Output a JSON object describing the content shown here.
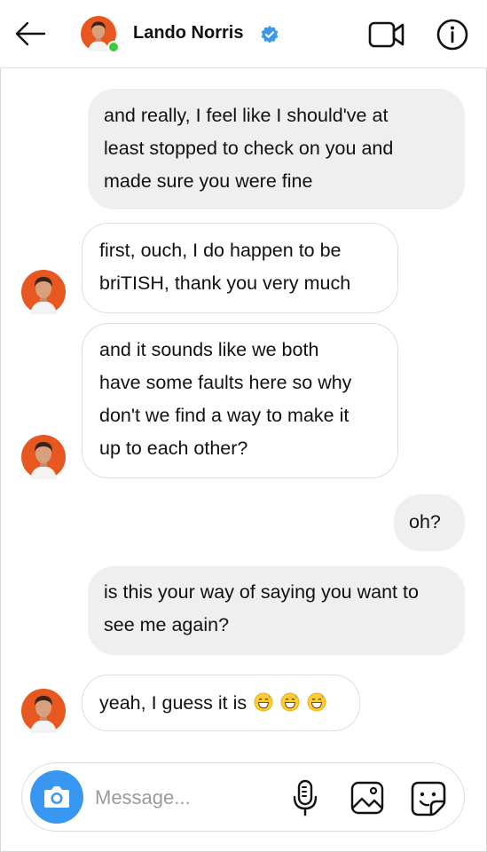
{
  "header": {
    "contact_name": "Lando Norris",
    "online": true,
    "icons": [
      "back-arrow-icon",
      "verified-badge-icon",
      "video-call-icon",
      "info-icon"
    ]
  },
  "messages": [
    {
      "sender": "me",
      "lines": [
        "and really, I feel like I should've at",
        "least stopped to check on you and",
        "made sure you were fine"
      ]
    },
    {
      "sender": "contact",
      "lines": [
        "first, ouch, I do happen to be",
        "briTISH, thank you very much"
      ]
    },
    {
      "sender": "contact",
      "lines": [
        "and it sounds like we both",
        "have some faults here so why",
        "don't we find a way to make it",
        "up to each other?"
      ]
    },
    {
      "sender": "me",
      "lines": [
        "oh?"
      ]
    },
    {
      "sender": "me",
      "lines": [
        "is this your way of saying you want to",
        "see me again?"
      ]
    },
    {
      "sender": "contact",
      "lines": [
        "yeah, I guess it is"
      ],
      "emoji": [
        "grinning-sweat-emoji",
        "grinning-sweat-emoji",
        "grinning-sweat-emoji"
      ]
    }
  ],
  "composer": {
    "placeholder": "Message...",
    "icons": [
      "camera-icon",
      "microphone-icon",
      "gallery-icon",
      "sticker-icon"
    ]
  },
  "colors": {
    "accent_blue": "#3897f0",
    "outgoing_bubble": "#efefef",
    "incoming_border": "#dedede",
    "online_green": "#3ec93a",
    "avatar_orange": "#e8571f"
  }
}
